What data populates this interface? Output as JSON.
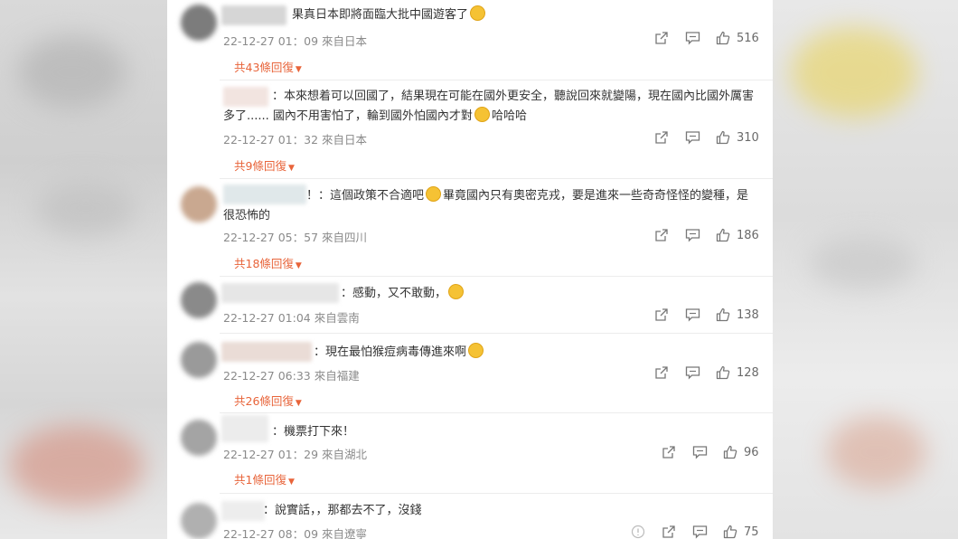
{
  "comments": [
    {
      "text": "果真日本即將面臨大批中國遊客了",
      "emoji_after": true,
      "time": "22-12-27 01：09",
      "location": "來自日本",
      "likes": "516",
      "replies": "共43條回復"
    },
    {
      "text": "：本來想着可以回國了，結果現在可能在國外更安全，聽說回來就變陽，現在國內比國外厲害多了...... 國內不用害怕了，輪到國外怕國內才對",
      "text_tail": "哈哈哈",
      "time": "22-12-27 01：32",
      "location": "來自日本",
      "likes": "310",
      "replies": "共9條回復"
    },
    {
      "text_prefix": "！：這個政策不合適吧",
      "text": "畢竟國內只有奧密克戎，要是進來一些奇奇怪怪的變種，是很恐怖的",
      "time": "22-12-27 05：57",
      "location": "來自四川",
      "likes": "186",
      "replies": "共18條回復"
    },
    {
      "text": "：感動，又不敢動，",
      "time": "22-12-27 01:04",
      "location": "來自雲南",
      "likes": "138"
    },
    {
      "text": "：現在最怕猴痘病毒傳進來啊",
      "time": "22-12-27 06:33",
      "location": "來自福建",
      "likes": "128",
      "replies": "共26條回復"
    },
    {
      "text": "：機票打下來！",
      "time": "22-12-27 01：29",
      "location": "來自湖北",
      "likes": "96",
      "replies": "共1條回復"
    },
    {
      "text": "：說實話，，那都去不了，沒錢",
      "time": "22-12-27 08：09",
      "location": "來自遼寧",
      "likes": "75"
    }
  ],
  "icons": {
    "share": "share-icon",
    "comment": "comment-icon",
    "like": "thumbs-up-icon",
    "info": "info-icon"
  },
  "colors": {
    "reply_link": "#e8643a",
    "meta": "#8a8a8a",
    "text": "#333333"
  }
}
